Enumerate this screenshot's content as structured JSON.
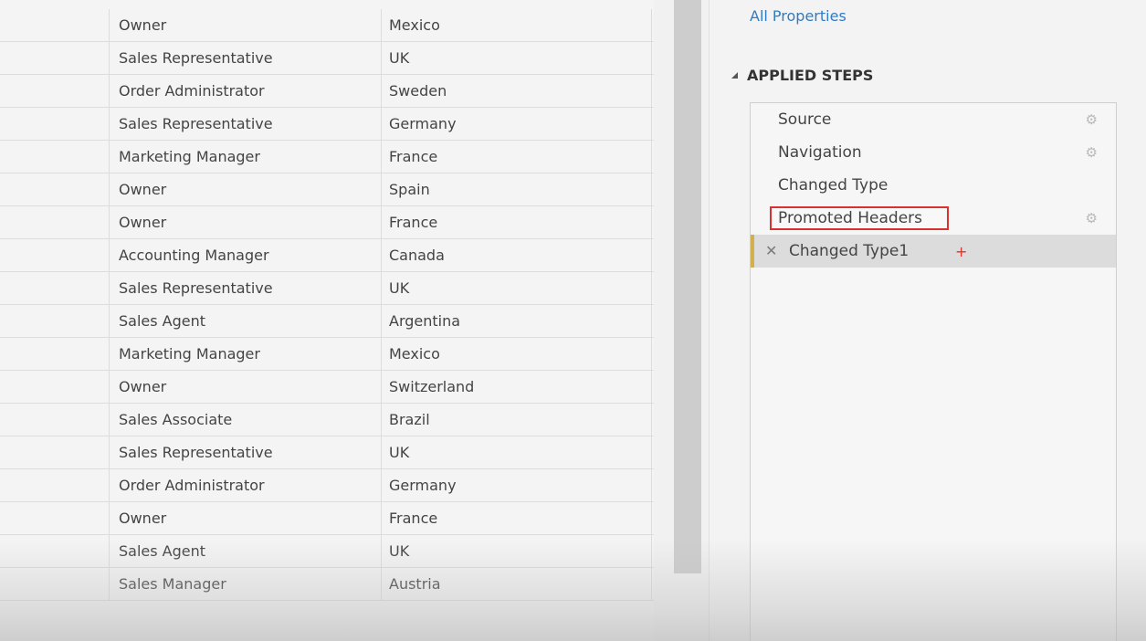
{
  "grid": {
    "rows": [
      {
        "title": "Owner",
        "country": "Mexico"
      },
      {
        "title": "Sales Representative",
        "country": "UK"
      },
      {
        "title": "Order Administrator",
        "country": "Sweden"
      },
      {
        "title": "Sales Representative",
        "country": "Germany"
      },
      {
        "title": "Marketing Manager",
        "country": "France"
      },
      {
        "title": "Owner",
        "country": "Spain"
      },
      {
        "title": "Owner",
        "country": "France"
      },
      {
        "title": "Accounting Manager",
        "country": "Canada"
      },
      {
        "title": "Sales Representative",
        "country": "UK"
      },
      {
        "title": "Sales Agent",
        "country": "Argentina"
      },
      {
        "title": "Marketing Manager",
        "country": "Mexico"
      },
      {
        "title": "Owner",
        "country": "Switzerland"
      },
      {
        "title": "Sales Associate",
        "country": "Brazil"
      },
      {
        "title": "Sales Representative",
        "country": "UK"
      },
      {
        "title": "Order Administrator",
        "country": "Germany"
      },
      {
        "title": "Owner",
        "country": "France"
      },
      {
        "title": "Sales Agent",
        "country": "UK"
      },
      {
        "title": "Sales Manager",
        "country": "Austria"
      }
    ]
  },
  "pane": {
    "all_properties_link": "All Properties",
    "applied_steps_header": "APPLIED STEPS",
    "steps": [
      {
        "label": "Source",
        "has_gear": true
      },
      {
        "label": "Navigation",
        "has_gear": true
      },
      {
        "label": "Changed Type",
        "has_gear": false
      },
      {
        "label": "Promoted Headers",
        "has_gear": true,
        "highlighted": true
      },
      {
        "label": "Changed Type1",
        "has_gear": false,
        "active": true
      }
    ],
    "delete_glyph": "✕",
    "gear_glyph": "⚙",
    "cursor_glyph": "+"
  },
  "colors": {
    "link": "#2f7bc4",
    "highlight_border": "#d9312b",
    "active_step_bar": "#d1b04d"
  }
}
